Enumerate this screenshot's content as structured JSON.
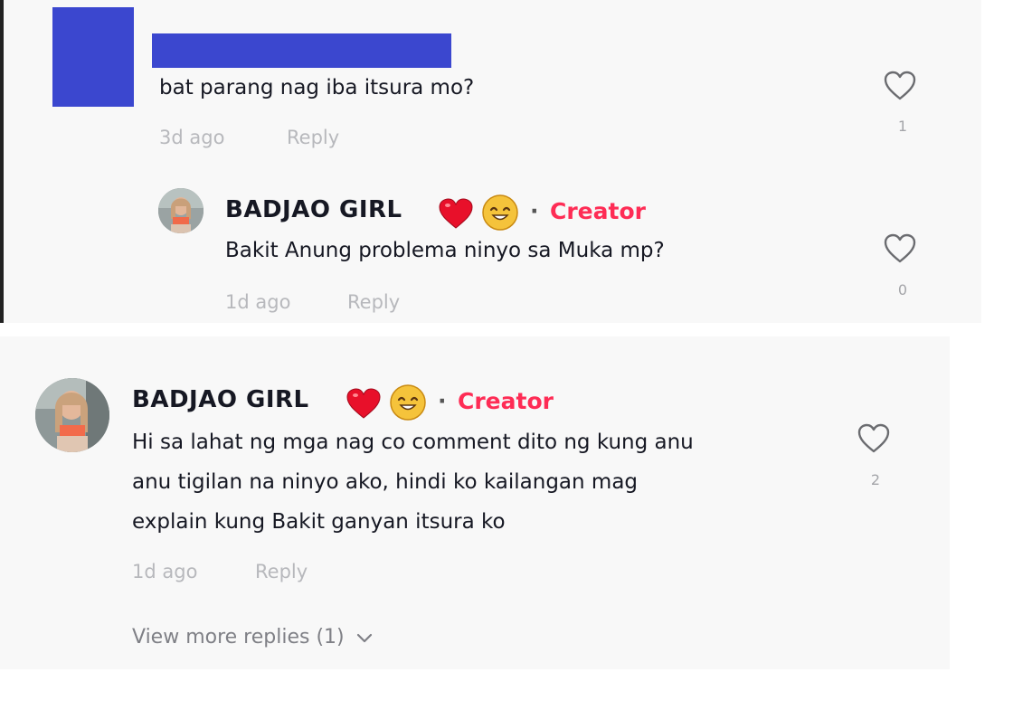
{
  "top_comment": {
    "text": "bat parang nag iba itsura mo?",
    "age": "3d ago",
    "reply_label": "Reply",
    "like_count": "1"
  },
  "reply": {
    "username": "BADJAO GIRL",
    "emoji": "❤️😊",
    "dot": "·",
    "badge": "Creator",
    "text": "Bakit Anung problema ninyo sa Muka mp?",
    "age": "1d ago",
    "reply_label": "Reply",
    "like_count": "0"
  },
  "creator_comment": {
    "username": "BADJAO GIRL",
    "dot": "·",
    "badge": "Creator",
    "lines": [
      "Hi sa lahat ng mga nag co comment dito ng kung anu",
      "anu tigilan na ninyo ako, hindi ko kailangan mag",
      "explain kung Bakit ganyan itsura ko"
    ],
    "age": "1d ago",
    "reply_label": "Reply",
    "like_count": "2",
    "view_more": "View more replies (1)"
  },
  "colors": {
    "creator_badge": "#fe2c55",
    "redaction": "#3b47cf",
    "panel_background": "#f8f8f8"
  }
}
